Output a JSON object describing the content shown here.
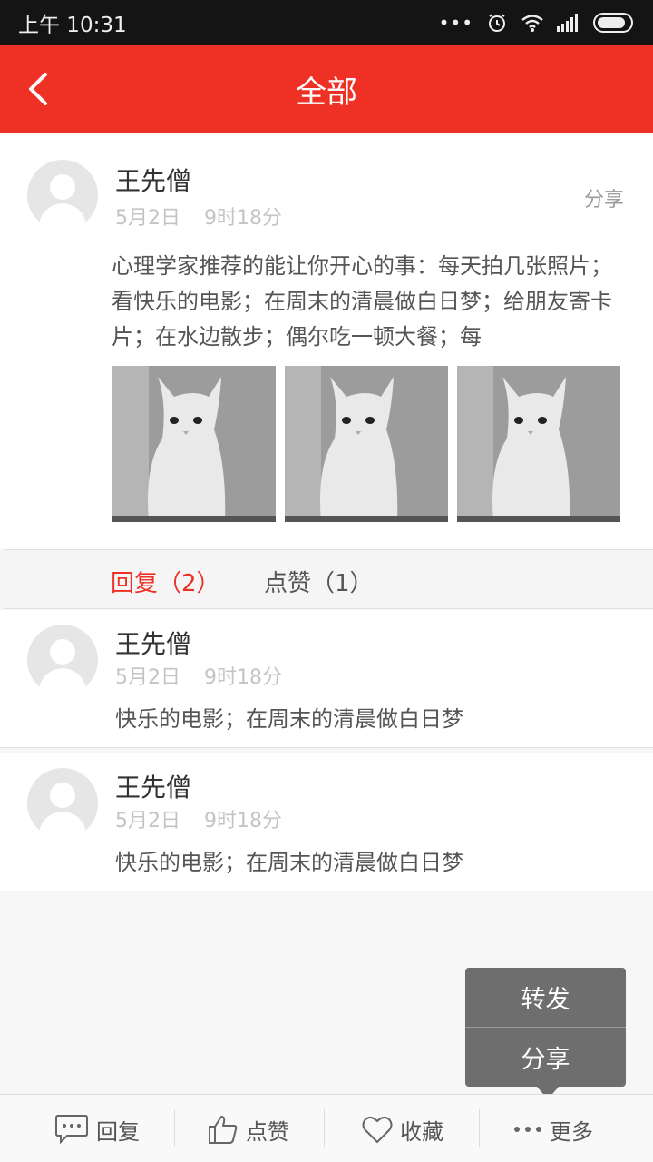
{
  "status_bar": {
    "time": "上午 10:31",
    "icons": [
      "more-dots-icon",
      "alarm-icon",
      "wifi-icon",
      "signal-icon",
      "battery-icon"
    ]
  },
  "nav": {
    "title": "全部",
    "back_icon": "chevron-left-icon"
  },
  "colors": {
    "brand_red": "#ee3124",
    "status_bar": "#141414",
    "popup_bg": "#6e6e6e"
  },
  "post": {
    "author": "王先僧",
    "date": "5月2日",
    "time": "9时18分",
    "share_label": "分享",
    "text": "心理学家推荐的能让你开心的事：每天拍几张照片；看快乐的电影；在周末的清晨做白日梦；给朋友寄卡片；在水边散步；偶尔吃一顿大餐；每",
    "images": [
      "cat-photo",
      "cat-photo",
      "cat-photo"
    ]
  },
  "tabs": {
    "reply": "回复（2）",
    "like": "点赞（1）"
  },
  "replies": [
    {
      "author": "王先僧",
      "date": "5月2日",
      "time": "9时18分",
      "text": "快乐的电影；在周末的清晨做白日梦"
    },
    {
      "author": "王先僧",
      "date": "5月2日",
      "time": "9时18分",
      "text": "快乐的电影；在周末的清晨做白日梦"
    }
  ],
  "popup_menu": {
    "forward": "转发",
    "share": "分享"
  },
  "toolbar": {
    "reply": "回复",
    "like": "点赞",
    "favorite": "收藏",
    "more": "更多"
  }
}
